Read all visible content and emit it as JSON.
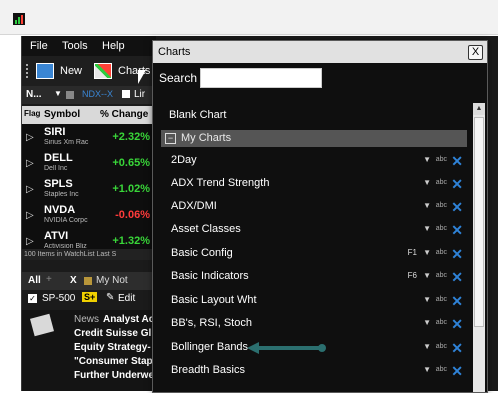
{
  "menu": {
    "file": "File",
    "tools": "Tools",
    "help": "Help"
  },
  "toolbar": {
    "new_label": "New",
    "charts_label": "Charts"
  },
  "watchlist_bar": {
    "name": "N...",
    "ndx": "NDX--X",
    "link": "Lir"
  },
  "table": {
    "headers": {
      "flag": "Flag",
      "symbol": "Symbol",
      "change": "% Change"
    },
    "rows": [
      {
        "symbol": "SIRI",
        "desc": "Sirius Xm Rac",
        "change": "+2.32%",
        "color": "#39d639"
      },
      {
        "symbol": "DELL",
        "desc": "Dell Inc",
        "change": "+0.65%",
        "color": "#39d639"
      },
      {
        "symbol": "SPLS",
        "desc": "Staples Inc",
        "change": "+1.02%",
        "color": "#39d639"
      },
      {
        "symbol": "NVDA",
        "desc": "NVIDIA Corpc",
        "change": "-0.06%",
        "color": "#ff3b3b"
      },
      {
        "symbol": "ATVI",
        "desc": "Activision Bliz",
        "change": "+1.32%",
        "color": "#39d639"
      }
    ],
    "status": "100 Items in WatchList    Last S"
  },
  "lower_tabs": {
    "all": "All",
    "x": "X",
    "my_not": "My Not"
  },
  "sp_bar": {
    "symbol": "SP-500",
    "badge": "S+",
    "edit": "Edit"
  },
  "news": {
    "label": "News",
    "lines": [
      "Analyst Ac",
      "Credit Suisse Gl",
      "Equity Strategy-",
      "\"Consumer Stap",
      "Further Underwe"
    ]
  },
  "dialog": {
    "title": "Charts",
    "close": "X",
    "search_label": "Search",
    "search_value": "",
    "blank_chart": "Blank Chart",
    "section": "My Charts",
    "section_toggle": "−",
    "items": [
      {
        "name": "2Day",
        "key": ""
      },
      {
        "name": "ADX Trend Strength",
        "key": ""
      },
      {
        "name": "ADX/DMI",
        "key": ""
      },
      {
        "name": "Asset Classes",
        "key": ""
      },
      {
        "name": "Basic Config",
        "key": "F1"
      },
      {
        "name": "Basic Indicators",
        "key": "F6"
      },
      {
        "name": "Basic Layout Wht",
        "key": ""
      },
      {
        "name": "BB's, RSI, Stoch",
        "key": ""
      },
      {
        "name": "Bollinger Bands",
        "key": ""
      },
      {
        "name": "Breadth Basics",
        "key": ""
      }
    ],
    "item_arrow": "▼",
    "item_abc": "abc",
    "item_delete": "✕"
  },
  "colors": {
    "delete_icon": "#2f83d8",
    "pointer_arrow": "#2b6f6f",
    "up": "#39d639",
    "down": "#ff3b3b"
  }
}
